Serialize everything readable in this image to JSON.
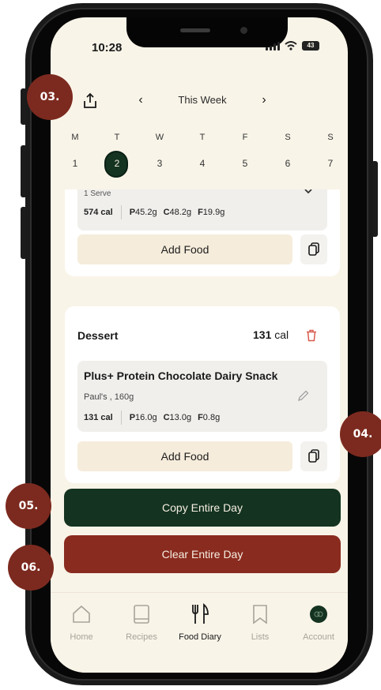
{
  "status_bar": {
    "time": "10:28",
    "battery": "43"
  },
  "week_nav": {
    "label": "This Week",
    "prev": "‹",
    "next": "›"
  },
  "days": {
    "letters": [
      "M",
      "T",
      "W",
      "T",
      "F",
      "S",
      "S"
    ],
    "dates": [
      "1",
      "2",
      "3",
      "4",
      "5",
      "6",
      "7"
    ],
    "selected_date": "2"
  },
  "meal_above": {
    "serving": "1 Serve",
    "calories": "574 cal",
    "protein": "45.2g",
    "carbs": "48.2g",
    "fat": "19.9g",
    "add_food": "Add Food"
  },
  "dessert": {
    "title": "Dessert",
    "total_value": "131",
    "total_unit": "cal",
    "item_name": "Plus+ Protein Chocolate Dairy Snack",
    "item_brand": "Paul's , 160g",
    "calories": "131 cal",
    "protein": "16.0g",
    "carbs": "13.0g",
    "fat": "0.8g",
    "add_food": "Add Food"
  },
  "macro_letters": {
    "p": "P",
    "c": "C",
    "f": "F"
  },
  "actions": {
    "copy_day": "Copy Entire Day",
    "clear_day": "Clear Entire Day"
  },
  "tabs": [
    {
      "label": "Home",
      "icon": "home-icon"
    },
    {
      "label": "Recipes",
      "icon": "book-icon"
    },
    {
      "label": "Food Diary",
      "icon": "fork-knife-icon"
    },
    {
      "label": "Lists",
      "icon": "bookmark-icon"
    },
    {
      "label": "Account",
      "icon": "avatar-icon"
    }
  ],
  "callouts": [
    "03.",
    "04.",
    "05.",
    "06."
  ],
  "colors": {
    "dark_green": "#143321",
    "brick_red": "#8a2b1f",
    "cream": "#f9f4e8",
    "callout": "#7c2a1f"
  }
}
